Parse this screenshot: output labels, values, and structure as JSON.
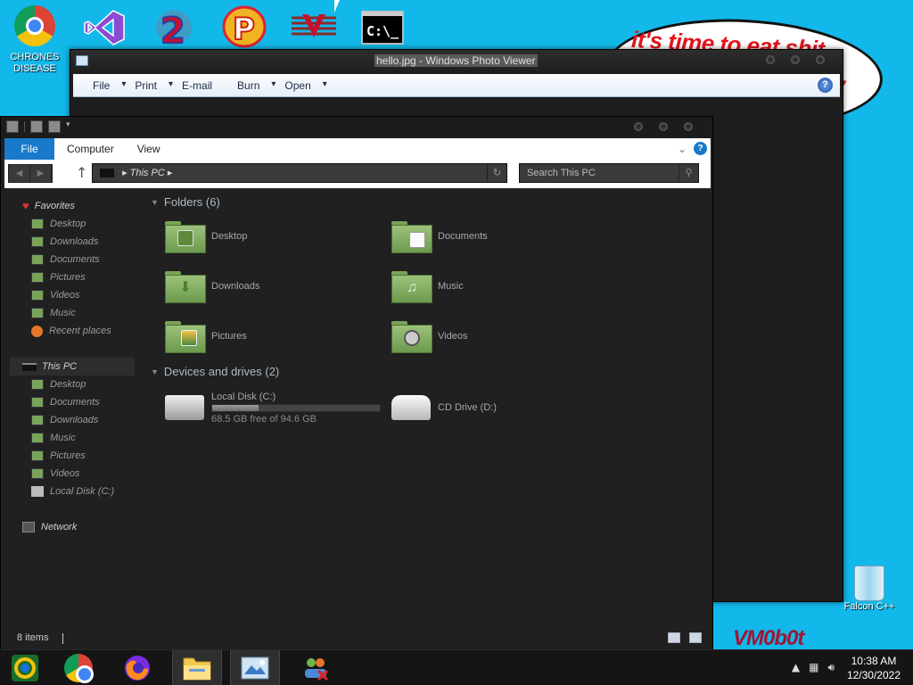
{
  "desktop": {
    "icons": [
      {
        "label": "CHRONES DISEASE"
      },
      {
        "label": ""
      },
      {
        "label": ""
      },
      {
        "label": ""
      },
      {
        "label": ""
      },
      {
        "label": ""
      }
    ],
    "speech_text_line1": "it's time to eat shit",
    "speech_text_line2": "y",
    "vm_logo": "VM0b0t",
    "recycle_bin_label": "Falcon C++"
  },
  "photo_viewer": {
    "title": "hello.jpg - Windows Photo Viewer",
    "menu": [
      "File",
      "Print",
      "E-mail",
      "Burn",
      "Open"
    ]
  },
  "explorer": {
    "ribbon_tabs": [
      "File",
      "Computer",
      "View"
    ],
    "address_path": "This PC",
    "search_placeholder": "Search This PC",
    "nav": {
      "favorites_label": "Favorites",
      "favorites": [
        "Desktop",
        "Downloads",
        "Documents",
        "Pictures",
        "Videos",
        "Music",
        "Recent places"
      ],
      "thispc_label": "This PC",
      "thispc": [
        "Desktop",
        "Documents",
        "Downloads",
        "Music",
        "Pictures",
        "Videos",
        "Local Disk (C:)"
      ],
      "network_label": "Network"
    },
    "folders_header": "Folders (6)",
    "folders": [
      {
        "name": "Desktop"
      },
      {
        "name": "Documents"
      },
      {
        "name": "Downloads"
      },
      {
        "name": "Music"
      },
      {
        "name": "Pictures"
      },
      {
        "name": "Videos"
      }
    ],
    "drives_header": "Devices and drives (2)",
    "drives": [
      {
        "name": "Local Disk (C:)",
        "free": "68.5 GB free of 94.6 GB",
        "used_fraction": 0.276
      },
      {
        "name": "CD Drive (D:)"
      }
    ],
    "status_count": "8 items"
  },
  "taskbar": {
    "time": "10:38 AM",
    "date": "12/30/2022"
  },
  "colors": {
    "desktop_bg": "#12b8ea",
    "accent": "#1979ca",
    "folder_green": "#7aa35a"
  }
}
